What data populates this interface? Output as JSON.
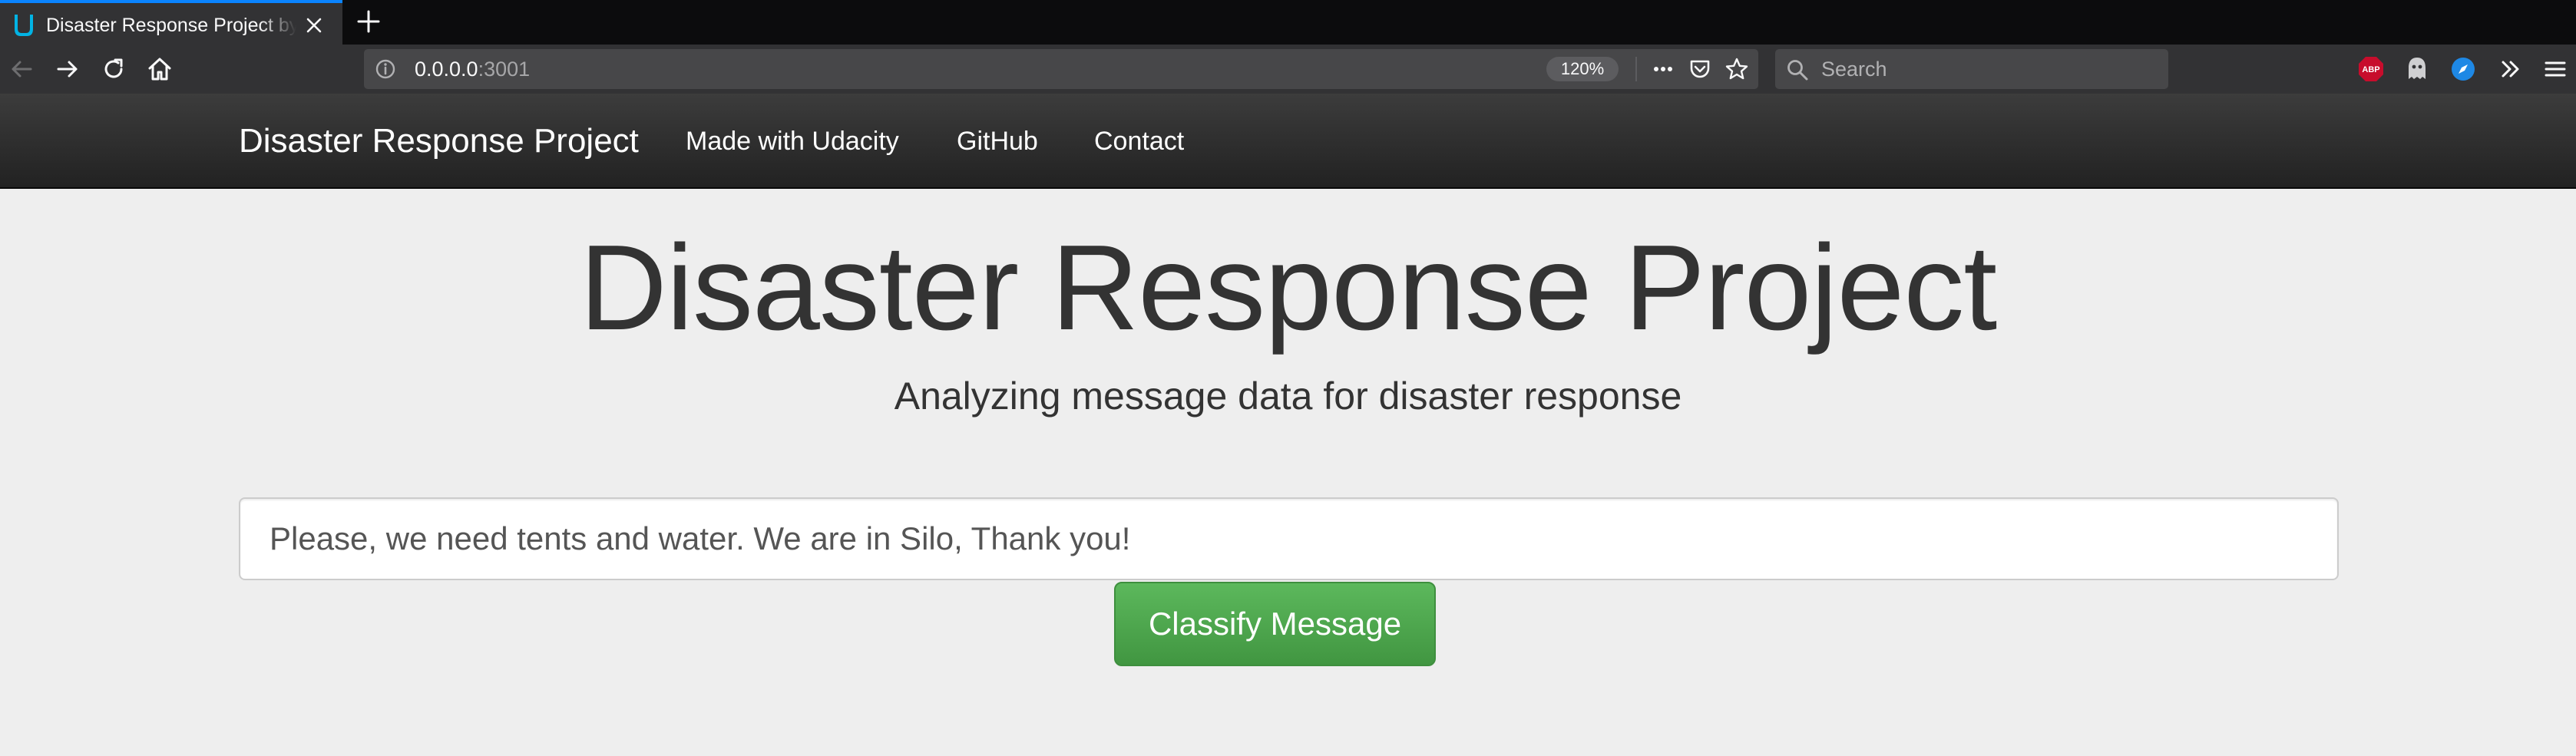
{
  "browser": {
    "tab": {
      "title": "Disaster Response Project by Sumit Saha"
    },
    "urlbar": {
      "host": "0.0.0.0",
      "port": ":3001",
      "zoom": "120%"
    },
    "search": {
      "placeholder": "Search"
    },
    "extensions": [
      {
        "icon": "adblock-plus-icon",
        "label": "ABP",
        "color": "#c70d2c"
      },
      {
        "icon": "ghostery-icon"
      },
      {
        "icon": "safari-compass-icon",
        "color": "#1e88e5"
      }
    ],
    "accent_color": "#0a84ff"
  },
  "navbar": {
    "brand": "Disaster Response Project",
    "links": [
      {
        "label": "Made with Udacity"
      },
      {
        "label": "GitHub"
      },
      {
        "label": "Contact"
      }
    ]
  },
  "hero": {
    "title": "Disaster Response Project",
    "subtitle": "Analyzing message data for disaster response"
  },
  "form": {
    "message_value": "Please, we need tents and water. We are in Silo, Thank you!",
    "button_label": "Classify Message",
    "button_color": "#5cb85c"
  }
}
